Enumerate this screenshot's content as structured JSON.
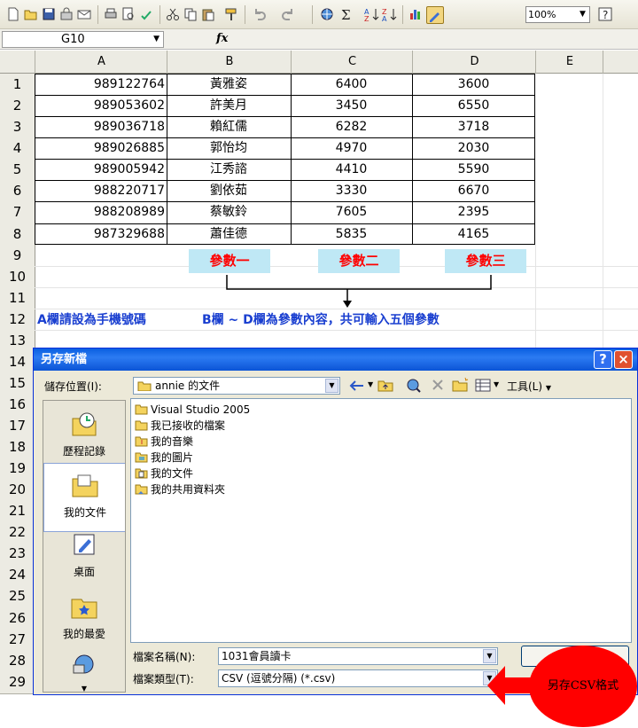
{
  "toolbar": {
    "zoom": "100%"
  },
  "formula_bar": {
    "cell_ref": "G10",
    "fx_label": "fx"
  },
  "columns": [
    "A",
    "B",
    "C",
    "D",
    "E"
  ],
  "rows": [
    "1",
    "2",
    "3",
    "4",
    "5",
    "6",
    "7",
    "8",
    "9",
    "10",
    "11",
    "12",
    "13",
    "14",
    "15",
    "16",
    "17",
    "18",
    "19",
    "20",
    "21",
    "22",
    "23",
    "24",
    "25",
    "26",
    "27",
    "28",
    "29"
  ],
  "table": [
    {
      "a": "989122764",
      "b": "黃雅姿",
      "c": "6400",
      "d": "3600"
    },
    {
      "a": "989053602",
      "b": "許美月",
      "c": "3450",
      "d": "6550"
    },
    {
      "a": "989036718",
      "b": "賴紅儒",
      "c": "6282",
      "d": "3718"
    },
    {
      "a": "989026885",
      "b": "郭怡均",
      "c": "4970",
      "d": "2030"
    },
    {
      "a": "989005942",
      "b": "江秀諮",
      "c": "4410",
      "d": "5590"
    },
    {
      "a": "988220717",
      "b": "劉依茹",
      "c": "3330",
      "d": "6670"
    },
    {
      "a": "988208989",
      "b": "蔡敏鈴",
      "c": "7605",
      "d": "2395"
    },
    {
      "a": "987329688",
      "b": "蕭佳德",
      "c": "5835",
      "d": "4165"
    }
  ],
  "params": [
    "參數一",
    "參數二",
    "參數三"
  ],
  "notes": {
    "col_a": "A欄請設為手機號碼",
    "col_bd": "B欄 ~ D欄為參數內容，共可輸入五個參數"
  },
  "dialog": {
    "title": "另存新檔",
    "help": "?",
    "close": "×",
    "save_in_label": "儲存位置(I):",
    "save_in_value": "annie 的文件",
    "tools_label": "工具(L)",
    "places": [
      "歷程記錄",
      "我的文件",
      "桌面",
      "我的最愛"
    ],
    "files": [
      "Visual Studio 2005",
      "我已接收的檔案",
      "我的音樂",
      "我的圖片",
      "我的文件",
      "我的共用資料夾"
    ],
    "filename_label": "檔案名稱(N):",
    "filename_value": "1031會員讀卡",
    "filetype_label": "檔案類型(T):",
    "filetype_value": "CSV (逗號分隔) (*.csv)"
  },
  "callout": "另存CSV格式",
  "colors": {
    "param_bg": "#bfe8f5",
    "param_text": "#ff0000",
    "note_text": "#1a3fd0",
    "titlebar": "#0a5fe0",
    "callout": "#ff0000"
  }
}
